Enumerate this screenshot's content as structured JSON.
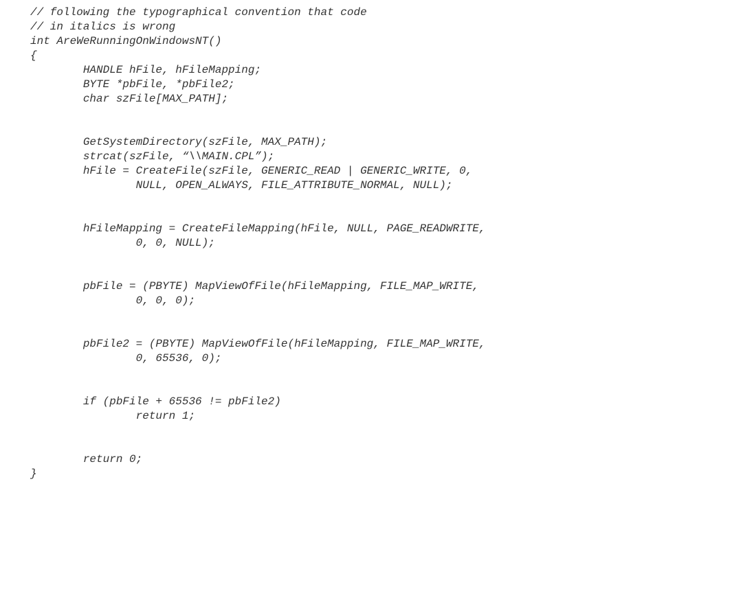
{
  "code": {
    "lines": [
      "// following the typographical convention that code",
      "// in italics is wrong",
      "int AreWeRunningOnWindowsNT()",
      "{",
      "        HANDLE hFile, hFileMapping;",
      "        BYTE *pbFile, *pbFile2;",
      "        char szFile[MAX_PATH];",
      "",
      "",
      "        GetSystemDirectory(szFile, MAX_PATH);",
      "        strcat(szFile, “\\\\MAIN.CPL”);",
      "        hFile = CreateFile(szFile, GENERIC_READ | GENERIC_WRITE, 0,",
      "                NULL, OPEN_ALWAYS, FILE_ATTRIBUTE_NORMAL, NULL);",
      "",
      "",
      "        hFileMapping = CreateFileMapping(hFile, NULL, PAGE_READWRITE,",
      "                0, 0, NULL);",
      "",
      "",
      "        pbFile = (PBYTE) MapViewOfFile(hFileMapping, FILE_MAP_WRITE,",
      "                0, 0, 0);",
      "",
      "",
      "        pbFile2 = (PBYTE) MapViewOfFile(hFileMapping, FILE_MAP_WRITE,",
      "                0, 65536, 0);",
      "",
      "",
      "        if (pbFile + 65536 != pbFile2)",
      "                return 1;",
      "",
      "",
      "        return 0;",
      "}"
    ]
  }
}
